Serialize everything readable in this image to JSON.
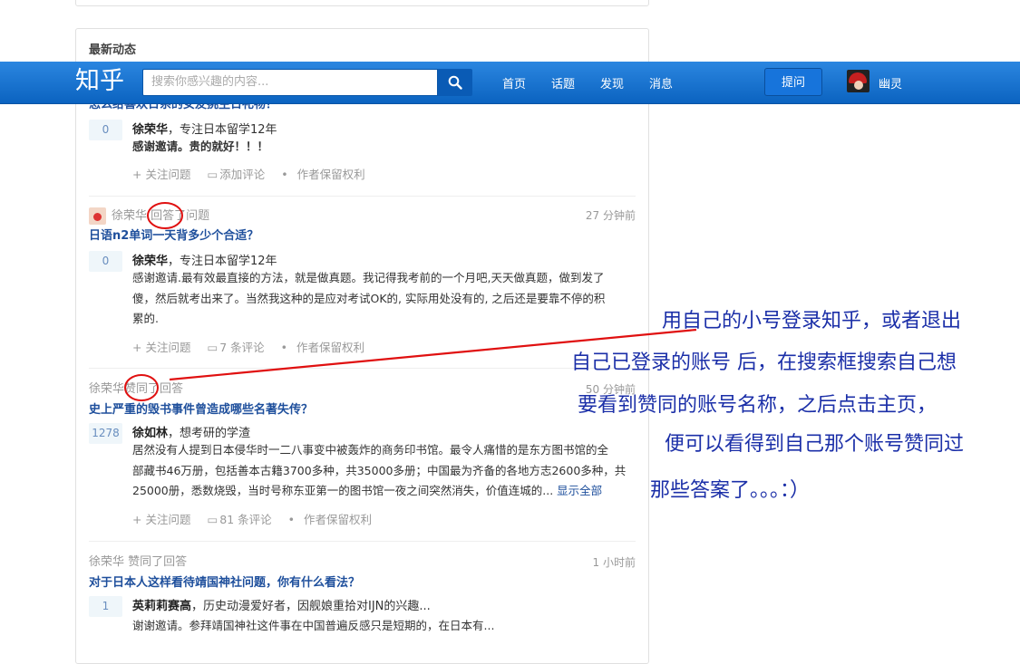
{
  "topbar": {
    "logo": "知乎",
    "search_placeholder": "搜索你感兴趣的内容...",
    "nav": [
      "首页",
      "话题",
      "发现",
      "消息"
    ],
    "ask_label": "提问",
    "username": "幽灵"
  },
  "feed": {
    "title": "最新动态",
    "items": [
      {
        "question": "怎么给喜欢日系的女友挑生日礼物？",
        "votes": "0",
        "author_name": "徐荣华",
        "author_bio": "，专注日本留学12年",
        "body": "感谢邀请。贵的就好！！！",
        "actions": [
          "+ 关注问题",
          "添加评论",
          "作者保留权利"
        ]
      },
      {
        "meta_user": "徐荣华",
        "meta_action": "回答",
        "meta_suffix": "了问题",
        "time": "27 分钟前",
        "question": "日语n2单词一天背多少个合适？",
        "votes": "0",
        "author_name": "徐荣华",
        "author_bio": "，专注日本留学12年",
        "body_lines": [
          "感谢邀请.最有效最直接的方法，就是做真题。我记得我考前的一个月吧,天天做真题，做到发了",
          "傻，然后就考出来了。当然我这种的是应对考试OK的, 实际用处没有的, 之后还是要靠不停的积",
          "累的."
        ],
        "actions": [
          "+ 关注问题",
          "7 条评论",
          "作者保留权利"
        ]
      },
      {
        "meta_user": "徐荣华",
        "meta_action": "赞同",
        "meta_suffix": "了回答",
        "time": "50 分钟前",
        "question": "史上严重的毁书事件曾造成哪些名著失传？",
        "votes": "1278",
        "author_name": "徐如林",
        "author_bio": "，想考研的学渣",
        "body_lines": [
          "居然没有人提到日本侵华时一二八事变中被轰炸的商务印书馆。最令人痛惜的是东方图书馆的全",
          "部藏书46万册，包括善本古籍3700多种，共35000多册；中国最为齐备的各地方志2600多种，共",
          "25000册，悉数烧毁，当时号称东亚第一的图书馆一夜之间突然消失，价值连城的..."
        ],
        "more_label": "显示全部",
        "actions": [
          "+ 关注问题",
          "81 条评论",
          "作者保留权利"
        ]
      },
      {
        "meta_user": "徐荣华",
        "meta_action": "赞同了回答",
        "time": "1 小时前",
        "question": "对于日本人这样看待靖国神社问题，你有什么看法？",
        "votes": "1",
        "author_name": "英莉莉赛高",
        "author_bio": "，历史动漫爱好者，因舰娘重拾对IJN的兴趣...",
        "body": "谢谢邀请。参拜靖国神社这件事在中国普遍反感只是短期的，在日本有..."
      }
    ]
  },
  "annotation": {
    "lines": [
      "用自己的小号登录知乎，或者退出",
      "自己已登录的账号 后，在搜索框搜索自己想",
      "要看到赞同的账号名称，之后点击主页，",
      "便可以看得到自己那个账号赞同过",
      "那些答案了。。。：）"
    ],
    "color": "#e01010"
  }
}
